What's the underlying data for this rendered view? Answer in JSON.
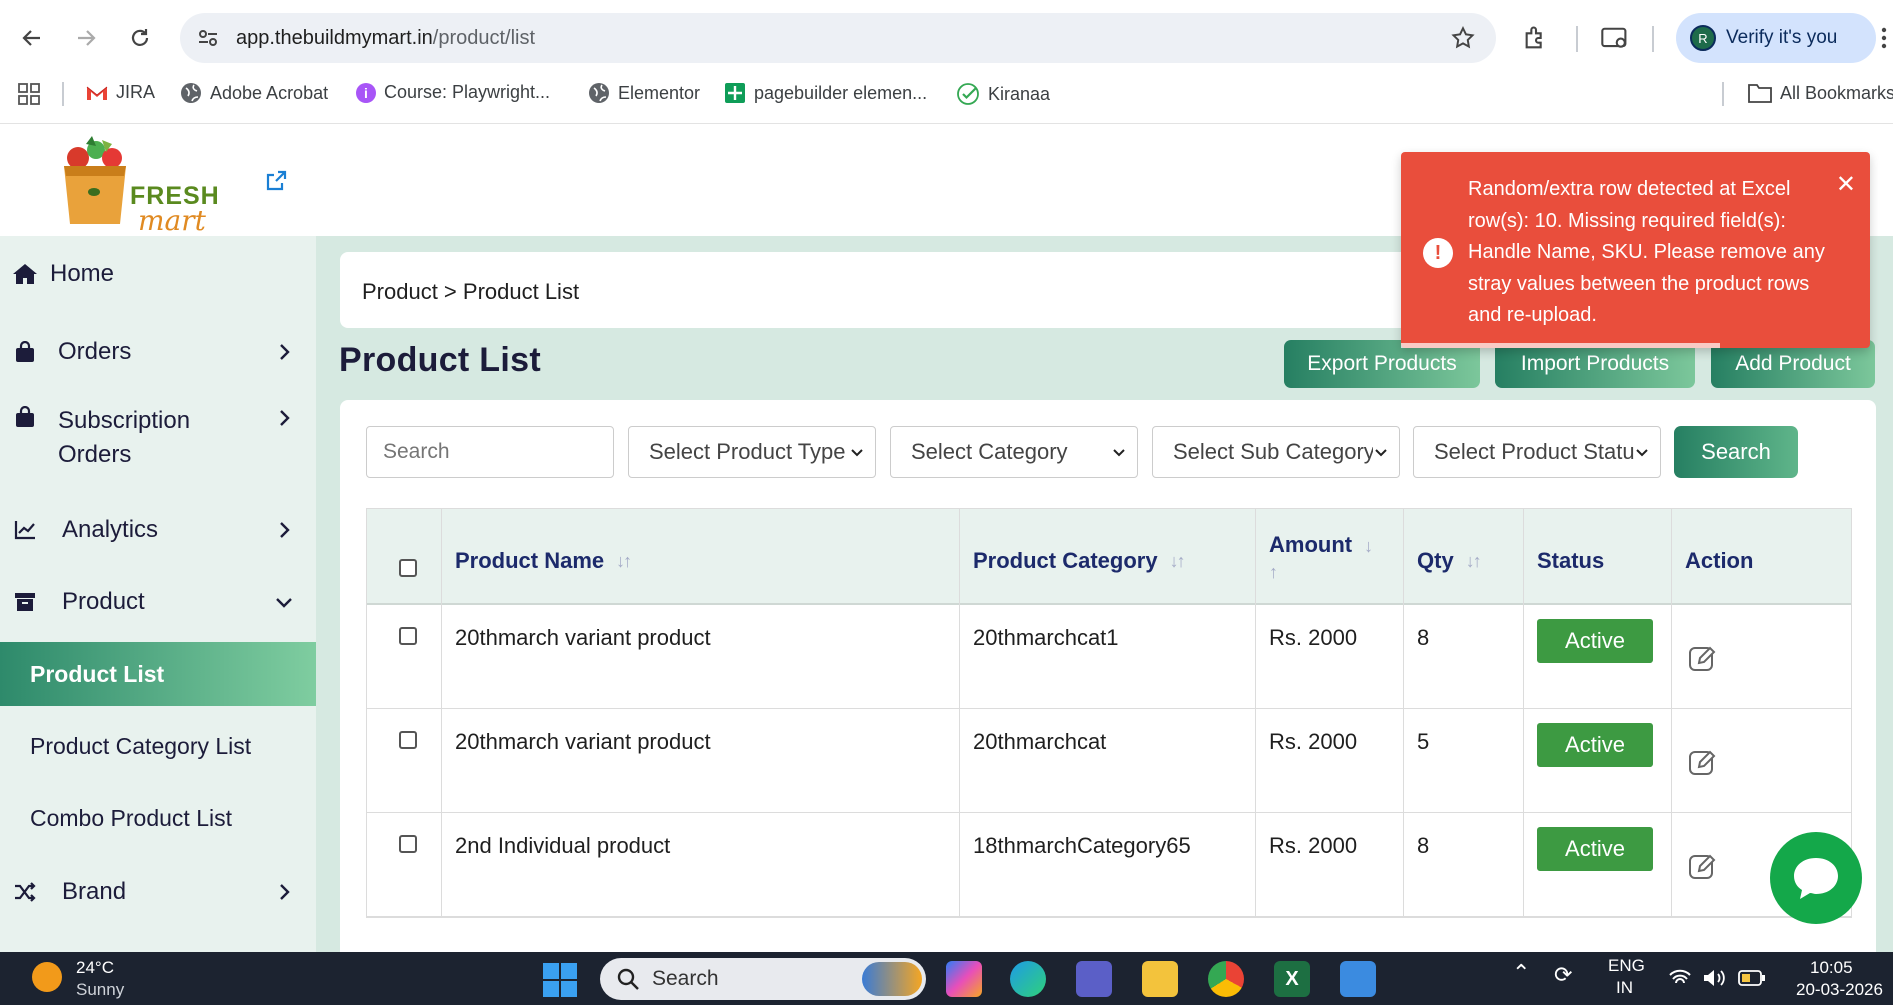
{
  "browser": {
    "url_host": "app.thebuildmymart.in",
    "url_path": "/product/list",
    "profile_initial": "R",
    "verify_label": "Verify it's you",
    "bookmarks": [
      {
        "label": "JIRA",
        "icon": "gmail-icon"
      },
      {
        "label": "Adobe Acrobat",
        "icon": "globe-icon"
      },
      {
        "label": "Course: Playwright...",
        "icon": "course-icon"
      },
      {
        "label": "Elementor",
        "icon": "globe-icon"
      },
      {
        "label": "pagebuilder elemen...",
        "icon": "sheets-icon"
      },
      {
        "label": "Kiranaa",
        "icon": "check-icon"
      }
    ],
    "all_bookmarks": "All Bookmarks"
  },
  "logo": {
    "top": "FRESH",
    "bottom": "mart"
  },
  "sidebar": {
    "home": "Home",
    "orders": "Orders",
    "subscription_line1": "Subscription",
    "subscription_line2": "Orders",
    "analytics": "Analytics",
    "product": "Product",
    "product_list": "Product List",
    "product_category_list": "Product Category List",
    "combo_product_list": "Combo Product List",
    "brand": "Brand"
  },
  "breadcrumb": "Product > Product List",
  "page_title": "Product List",
  "actions": {
    "export": "Export Products",
    "import": "Import Products",
    "add": "Add Product"
  },
  "filters": {
    "search_placeholder": "Search",
    "product_type": "Select Product Type",
    "category": "Select Category",
    "sub_category": "Select Sub Category",
    "product_status": "Select Product Status",
    "search_button": "Search"
  },
  "table": {
    "headers": {
      "name": "Product Name",
      "category": "Product Category",
      "amount": "Amount",
      "qty": "Qty",
      "status": "Status",
      "action": "Action"
    },
    "rows": [
      {
        "name": "20thmarch variant product",
        "category": "20thmarchcat1",
        "amount": "Rs. 2000",
        "qty": "8",
        "status": "Active"
      },
      {
        "name": "20thmarch variant product",
        "category": "20thmarchcat",
        "amount": "Rs. 2000",
        "qty": "5",
        "status": "Active"
      },
      {
        "name": "2nd Individual product",
        "category": "18thmarchCategory65",
        "amount": "Rs. 2000",
        "qty": "8",
        "status": "Active"
      }
    ]
  },
  "toast": {
    "message": "Random/extra row detected at Excel row(s): 10. Missing required field(s): Handle Name, SKU. Please remove any stray values between the product rows and re-upload.",
    "progress": 0.68
  },
  "taskbar": {
    "temp": "24°C",
    "weather": "Sunny",
    "search": "Search",
    "lang_top": "ENG",
    "lang_bottom": "IN",
    "time": "10:05",
    "date": "20-03-2026"
  },
  "colors": {
    "accent": "#267f62",
    "toast": "#e94e3c",
    "active_badge": "#3d9a42"
  }
}
